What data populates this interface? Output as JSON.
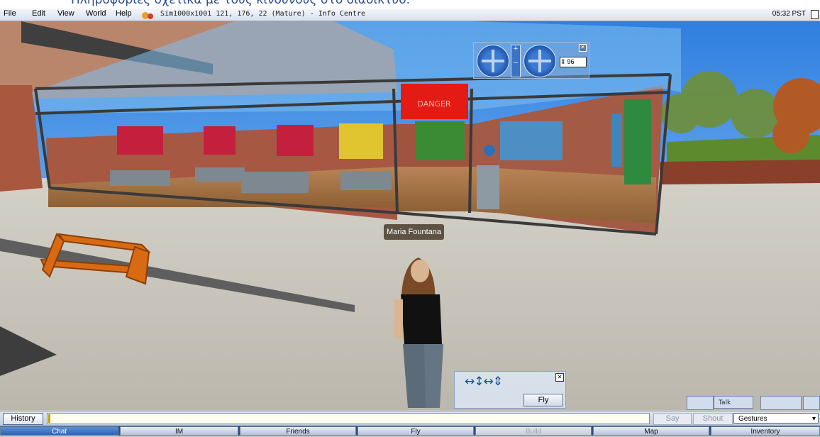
{
  "caption": "Πληροφορίες σχετικά με τους κινδύνους στο διαδίκτυο.",
  "menu": [
    "File",
    "Edit",
    "View",
    "World",
    "Help"
  ],
  "location": "Sim1000x1001 121, 176, 22 (Mature) - Info Centre",
  "clock": "05:32 PST",
  "camera_controls": {
    "zoom_value": "96",
    "close": "✕",
    "zoom_plus": "+",
    "zoom_minus": "−"
  },
  "sign_text": "DANGER",
  "avatar_name": "Maria Fountana",
  "movement": {
    "fly_label": "Fly",
    "close": "✕",
    "arrows": "↔↕↔⇕"
  },
  "media": {
    "talk_label": "Talk"
  },
  "chatbar": {
    "history_label": "History",
    "say_label": "Say",
    "shout_label": "Shout",
    "gestures_label": "Gestures"
  },
  "toolbar": [
    "Chat",
    "IM",
    "Friends",
    "Fly",
    "Build",
    "Map",
    "Inventory"
  ]
}
